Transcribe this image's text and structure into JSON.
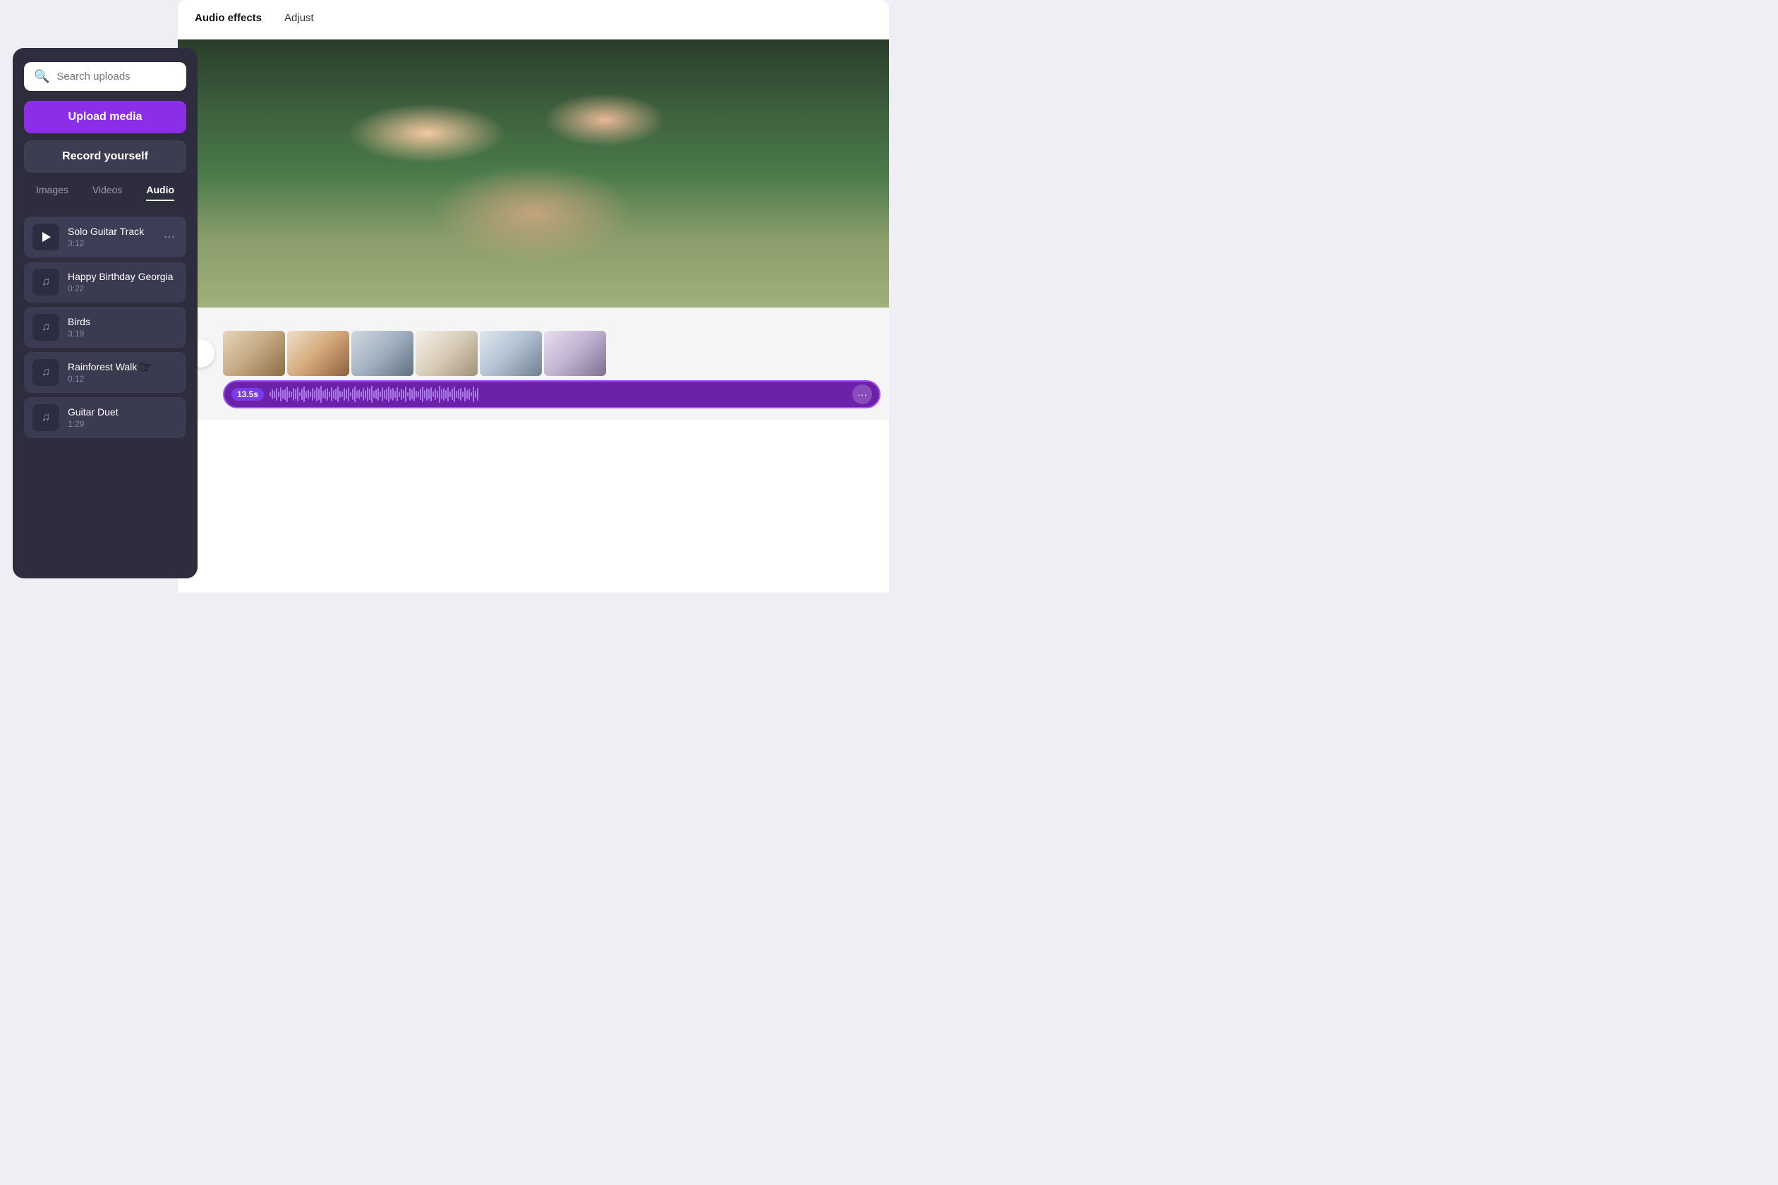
{
  "tabs": {
    "audio_effects": "Audio effects",
    "adjust": "Adjust"
  },
  "search": {
    "placeholder": "Search uploads"
  },
  "buttons": {
    "upload": "Upload media",
    "record": "Record yourself"
  },
  "categories": [
    {
      "id": "images",
      "label": "Images",
      "active": false
    },
    {
      "id": "videos",
      "label": "Videos",
      "active": false
    },
    {
      "id": "audio",
      "label": "Audio",
      "active": true
    }
  ],
  "audio_items": [
    {
      "id": "solo-guitar",
      "title": "Solo Guitar Track",
      "duration": "3:12",
      "active": true
    },
    {
      "id": "happy-birthday",
      "title": "Happy Birthday Georgia",
      "duration": "0:22",
      "active": false
    },
    {
      "id": "birds",
      "title": "Birds",
      "duration": "3:19",
      "active": false
    },
    {
      "id": "rainforest-walk",
      "title": "Rainforest Walk",
      "duration": "0:12",
      "active": false
    },
    {
      "id": "guitar-duet",
      "title": "Guitar Duet",
      "duration": "1:29",
      "active": false
    }
  ],
  "timeline": {
    "time_badge": "13.5s",
    "more_label": "···"
  }
}
